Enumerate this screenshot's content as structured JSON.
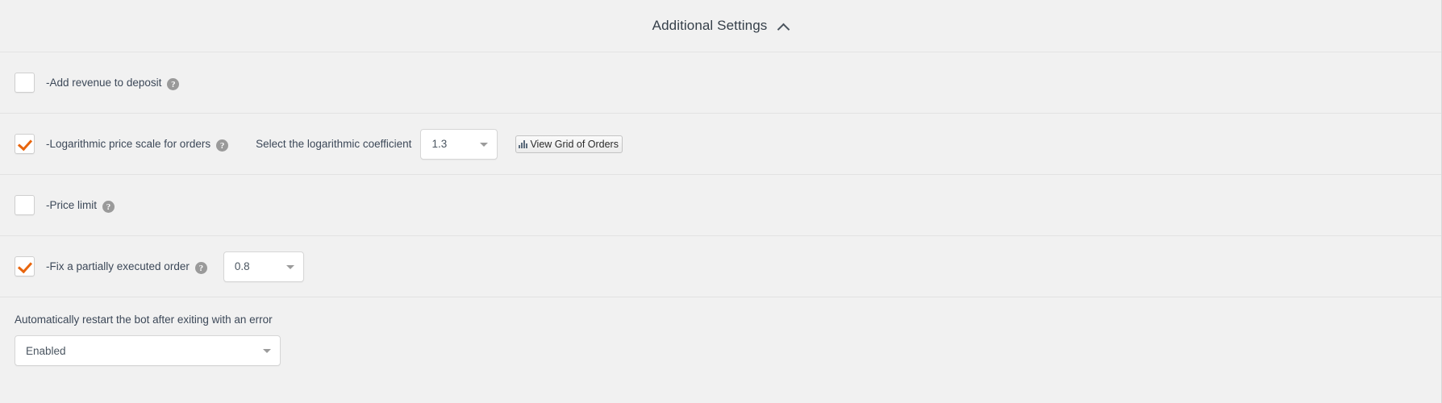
{
  "header": {
    "title": "Additional Settings",
    "collapse_icon": "chevron-up-icon"
  },
  "rows": [
    {
      "checkbox_label": "-Add revenue to deposit",
      "checked": false,
      "help_icon": "question-mark-icon",
      "help_glyph": "?"
    },
    {
      "checkbox_label": "-Logarithmic price scale for orders",
      "checked": true,
      "help_icon": "question-mark-icon",
      "help_glyph": "?",
      "inline_label": "Select the logarithmic coefficient",
      "select_value": "1.3",
      "button_label": "View Grid of Orders",
      "button_icon": "bar-chart-icon"
    },
    {
      "checkbox_label": "-Price limit",
      "checked": false,
      "help_icon": "question-mark-icon",
      "help_glyph": "?"
    },
    {
      "checkbox_label": "-Fix a partially executed order",
      "checked": true,
      "help_icon": "question-mark-icon",
      "help_glyph": "?",
      "select_value": "0.8"
    }
  ],
  "bottom": {
    "label": "Automatically restart the bot after exiting with an error",
    "select_value": "Enabled"
  },
  "colors": {
    "background": "#f1f1f1",
    "checkmark": "#e8650d",
    "text": "#3c4858",
    "divider": "#e2e2e2",
    "help_badge": "#9a9a9a"
  }
}
